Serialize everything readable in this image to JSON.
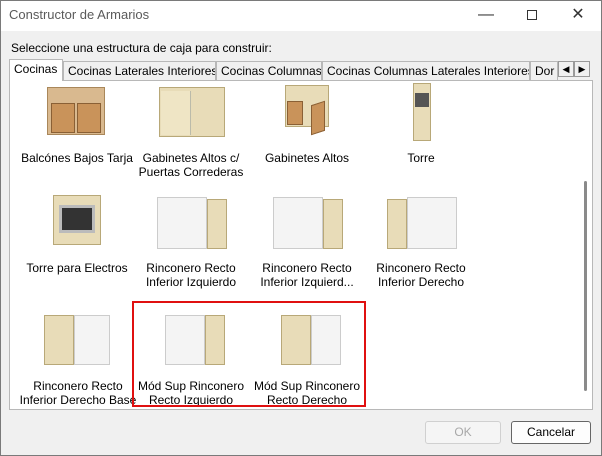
{
  "window": {
    "title": "Constructor de Armarios"
  },
  "titlebar_icons": [
    "minimize-icon",
    "maximize-icon",
    "close-icon"
  ],
  "prompt": "Seleccione una estructura de caja para construir:",
  "tabs": [
    {
      "label": "Cocinas",
      "active": true
    },
    {
      "label": "Cocinas Laterales Interiores"
    },
    {
      "label": "Cocinas Columnas"
    },
    {
      "label": "Cocinas Columnas Laterales Interiores"
    },
    {
      "label": "Dor"
    }
  ],
  "items": [
    {
      "label": "Balcónes Bajos Tarja",
      "icon": "base-sink-cabinet-icon"
    },
    {
      "label": "Gabinetes Altos c/ Puertas Correderas",
      "icon": "sliding-door-wall-cabinet-icon"
    },
    {
      "label": "Gabinetes Altos",
      "icon": "wall-cabinet-icon"
    },
    {
      "label": "Torre",
      "icon": "tower-cabinet-icon"
    },
    {
      "label": "Torre para Electros",
      "icon": "appliance-tower-icon"
    },
    {
      "label": "Rinconero Recto Inferior Izquierdo",
      "icon": "corner-cabinet-icon"
    },
    {
      "label": "Rinconero Recto Inferior Izquierd...",
      "icon": "corner-cabinet-icon"
    },
    {
      "label": "Rinconero Recto Inferior Derecho",
      "icon": "corner-cabinet-icon"
    },
    {
      "label": "Rinconero Recto Inferior Derecho Base",
      "icon": "corner-cabinet-icon"
    },
    {
      "label": "Mód Sup Rinconero Recto Izquierdo",
      "icon": "corner-cabinet-icon"
    },
    {
      "label": "Mód Sup Rinconero Recto Derecho",
      "icon": "corner-cabinet-icon"
    }
  ],
  "buttons": {
    "ok": "OK",
    "cancel": "Cancelar"
  },
  "colors": {
    "highlight": "#e01010",
    "wood": "#c9935a",
    "beige": "#e8dcb8"
  }
}
